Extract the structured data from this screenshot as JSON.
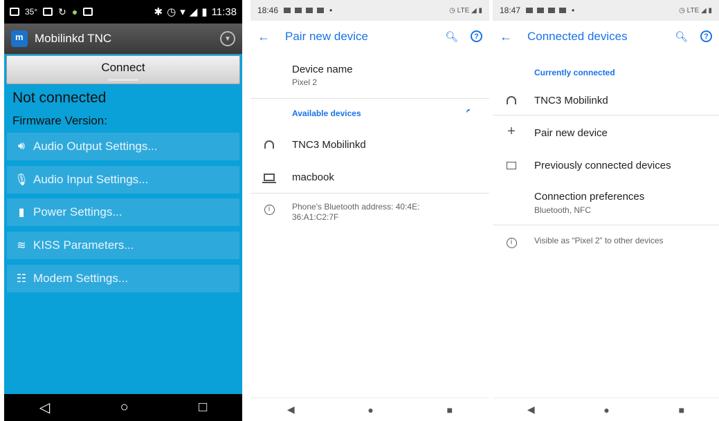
{
  "screen1": {
    "status": {
      "temp": "35°",
      "time": "11:38"
    },
    "app_title": "Mobilinkd TNC",
    "connect_label": "Connect",
    "status_text": "Not connected",
    "firmware_label": "Firmware Version:",
    "items": [
      {
        "label": "Audio Output Settings...",
        "icon": "speaker-icon"
      },
      {
        "label": "Audio Input Settings...",
        "icon": "microphone-icon"
      },
      {
        "label": "Power Settings...",
        "icon": "battery-icon"
      },
      {
        "label": "KISS Parameters...",
        "icon": "wifi-icon"
      },
      {
        "label": "Modem Settings...",
        "icon": "sliders-icon"
      }
    ],
    "nav": {
      "back": "◁",
      "home": "○",
      "recents": "□"
    }
  },
  "screen2": {
    "status": {
      "time": "18:46",
      "right": "◷ LTE ◢ ▮"
    },
    "title": "Pair new device",
    "device_name_label": "Device name",
    "device_name_value": "Pixel 2",
    "available_header": "Available devices",
    "devices": [
      {
        "name": "TNC3 Mobilinkd",
        "icon": "headphones-icon"
      },
      {
        "name": "macbook",
        "icon": "laptop-icon"
      }
    ],
    "bt_address_line1": "Phone's Bluetooth address: 40:4E:",
    "bt_address_line2": "36:A1:C2:7F",
    "nav": {
      "back": "◀",
      "home": "●",
      "recents": "■"
    }
  },
  "screen3": {
    "status": {
      "time": "18:47",
      "right": "◷ LTE ◢ ▮"
    },
    "title": "Connected devices",
    "currently_connected": "Currently connected",
    "connected_device": "TNC3 Mobilinkd",
    "pair_new": "Pair new device",
    "previously_connected": "Previously connected devices",
    "conn_prefs": "Connection preferences",
    "conn_prefs_sub": "Bluetooth, NFC",
    "visible_as": "Visible as “Pixel 2” to other devices",
    "nav": {
      "back": "◀",
      "home": "●",
      "recents": "■"
    }
  }
}
